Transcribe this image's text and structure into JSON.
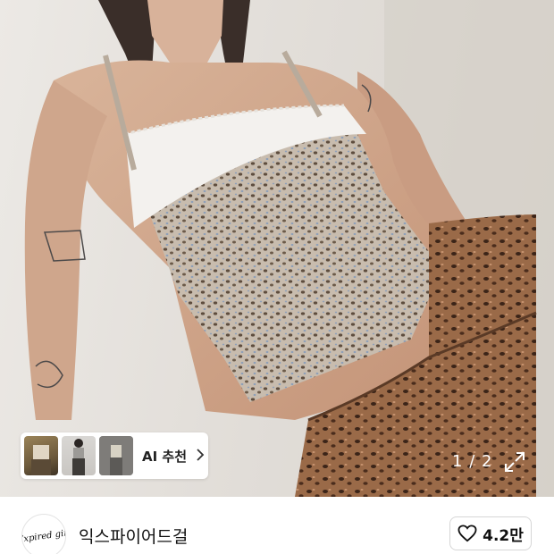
{
  "product_image": {
    "alt": "",
    "pager": {
      "current": "1",
      "separator": "/",
      "total": "2"
    },
    "expand_icon": "expand-arrows-icon"
  },
  "ai_recommend": {
    "label": "AI 추천",
    "thumbnails": [
      "thumb-1",
      "thumb-2",
      "thumb-3"
    ],
    "chevron_icon": "chevron-right-icon"
  },
  "shop": {
    "name": "익스파이어드걸",
    "logo_text": "Expired girl",
    "like_count": "4.2만",
    "like_icon": "heart-outline-icon"
  },
  "colors": {
    "leopard_light": "#bfb2a4",
    "leopard_spot": "#5a4a3c",
    "skirt": "#8a5a3c",
    "lace": "#f4f2ef"
  }
}
